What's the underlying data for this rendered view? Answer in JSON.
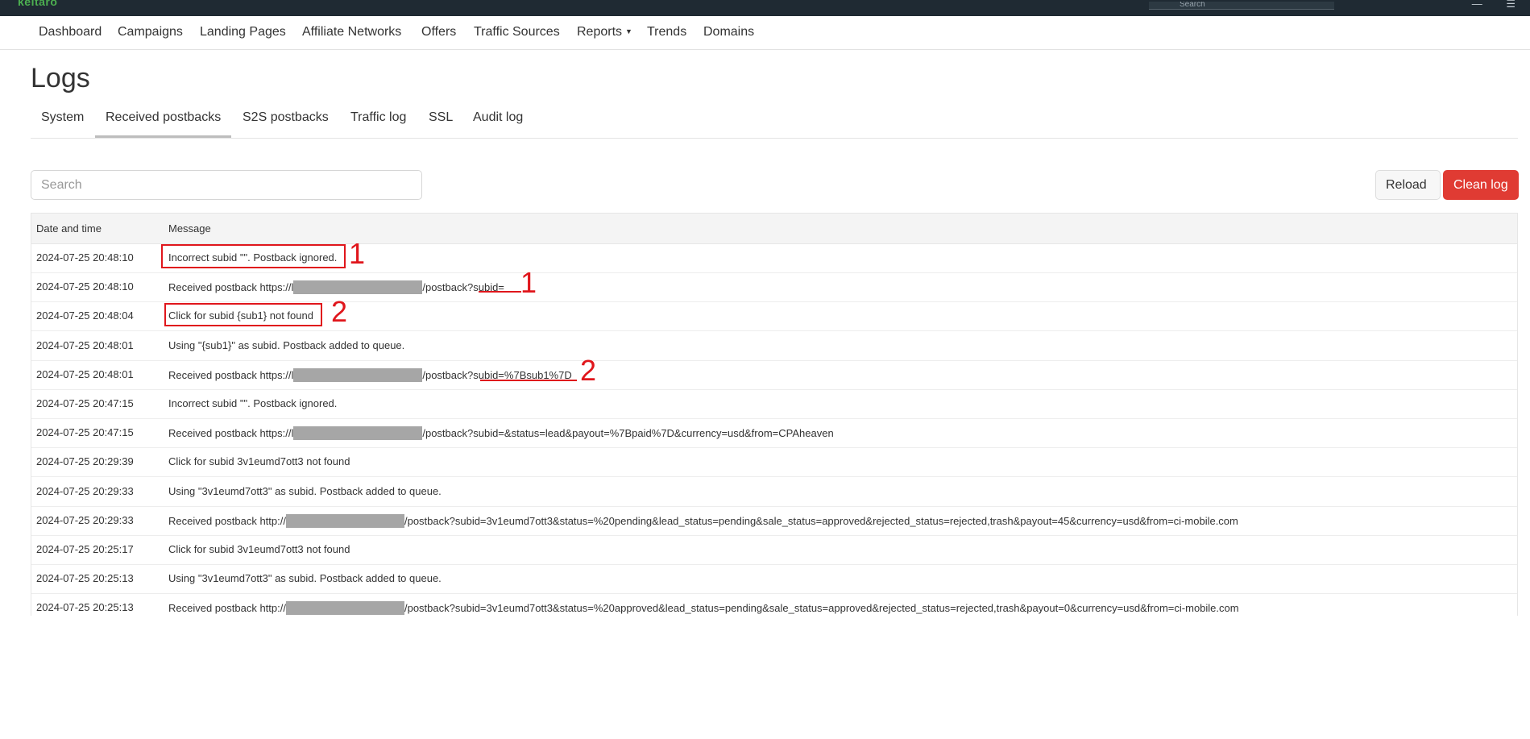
{
  "app": {
    "logo": "keitaro",
    "top_search_placeholder": "Search"
  },
  "nav": {
    "items": [
      "Dashboard",
      "Campaigns",
      "Landing Pages",
      "Affiliate Networks",
      "Offers",
      "Traffic Sources",
      "Reports",
      "Trends",
      "Domains"
    ]
  },
  "page": {
    "title": "Logs"
  },
  "tabs": [
    "System",
    "Received postbacks",
    "S2S postbacks",
    "Traffic log",
    "SSL",
    "Audit log"
  ],
  "active_tab": "Received postbacks",
  "search": {
    "placeholder": "Search"
  },
  "buttons": {
    "reload": "Reload",
    "clean": "Clean log"
  },
  "table": {
    "columns": [
      "Date and time",
      "Message"
    ],
    "rows": [
      {
        "time": "2024-07-25 20:48:10",
        "pre": "Incorrect subid \"\". Postback ignored.",
        "post": ""
      },
      {
        "time": "2024-07-25 20:48:10",
        "pre": "Received postback https://l",
        "post": "/postback?subid="
      },
      {
        "time": "2024-07-25 20:48:04",
        "pre": "Click for subid {sub1} not found",
        "post": ""
      },
      {
        "time": "2024-07-25 20:48:01",
        "pre": "Using \"{sub1}\" as subid. Postback added to queue.",
        "post": ""
      },
      {
        "time": "2024-07-25 20:48:01",
        "pre": "Received postback https://l",
        "post": "/postback?subid=%7Bsub1%7D"
      },
      {
        "time": "2024-07-25 20:47:15",
        "pre": "Incorrect subid \"\". Postback ignored.",
        "post": ""
      },
      {
        "time": "2024-07-25 20:47:15",
        "pre": "Received postback https://l",
        "post": "/postback?subid=&status=lead&payout=%7Bpaid%7D&currency=usd&from=CPAheaven"
      },
      {
        "time": "2024-07-25 20:29:39",
        "pre": "Click for subid 3v1eumd7ott3 not found",
        "post": ""
      },
      {
        "time": "2024-07-25 20:29:33",
        "pre": "Using \"3v1eumd7ott3\" as subid. Postback added to queue.",
        "post": ""
      },
      {
        "time": "2024-07-25 20:29:33",
        "pre": "Received postback http://",
        "post": "/postback?subid=3v1eumd7ott3&status=%20pending&lead_status=pending&sale_status=approved&rejected_status=rejected,trash&payout=45&currency=usd&from=ci-mobile.com"
      },
      {
        "time": "2024-07-25 20:25:17",
        "pre": "Click for subid 3v1eumd7ott3 not found",
        "post": ""
      },
      {
        "time": "2024-07-25 20:25:13",
        "pre": "Using \"3v1eumd7ott3\" as subid. Postback added to queue.",
        "post": ""
      },
      {
        "time": "2024-07-25 20:25:13",
        "pre": "Received postback http://",
        "post": "/postback?subid=3v1eumd7ott3&status=%20approved&lead_status=pending&sale_status=approved&rejected_status=rejected,trash&payout=0&currency=usd&from=ci-mobile.com"
      }
    ]
  },
  "annotations": [
    "1",
    "1",
    "2",
    "2"
  ],
  "colors": {
    "accent_red": "#e03b33",
    "annotation_red": "#e0161c",
    "topbar": "#1f2a33"
  }
}
